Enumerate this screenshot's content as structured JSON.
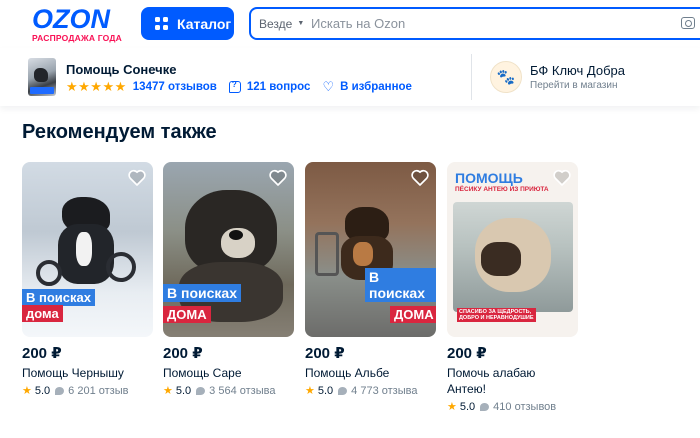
{
  "header": {
    "logo_text": "OZON",
    "logo_subtitle": "РАСПРОДАЖА ГОДА",
    "catalog_label": "Каталог",
    "search_scope": "Везде",
    "search_placeholder": "Искать на Ozon"
  },
  "seller": {
    "name": "Помощь Сонечке",
    "stars": "★★★★★",
    "reviews": "13477 отзывов",
    "questions": "121 вопрос",
    "favorites": "В избранное"
  },
  "fund": {
    "name": "БФ Ключ Добра",
    "link": "Перейти в магазин"
  },
  "section_title": "Рекомендуем также",
  "colors": {
    "brand_blue": "#005bff",
    "accent_pink": "#f91155",
    "star": "#ffa800",
    "tag_blue": "#2f7de1",
    "tag_red": "#d9263f"
  },
  "cards": [
    {
      "price": "200 ₽",
      "title": "Помощь Чернышу",
      "rating": "5.0",
      "reviews": "6 201 отзыв",
      "tag1": "В поисках",
      "tag2": "дома"
    },
    {
      "price": "200 ₽",
      "title": "Помощь Саре",
      "rating": "5.0",
      "reviews": "3 564 отзыва",
      "tag1": "В поисках",
      "tag2": "ДОМА"
    },
    {
      "price": "200 ₽",
      "title": "Помощь Альбе",
      "rating": "5.0",
      "reviews": "4 773 отзыва",
      "tag1": "В поисках",
      "tag2": "ДОМА"
    },
    {
      "price": "200 ₽",
      "title": "Помочь алабаю Антею!",
      "rating": "5.0",
      "reviews": "410 отзывов",
      "poster_title": "ПОМОЩЬ",
      "poster_subtitle": "ПЁСИКУ АНТЕЮ ИЗ ПРИЮТА",
      "poster_thanks_1": "СПАСИБО",
      "poster_thanks_2": "ЗА ЩЕДРОСТЬ,",
      "poster_thanks_3": "ДОБРО И НЕРАВНОДУШИЕ"
    }
  ]
}
